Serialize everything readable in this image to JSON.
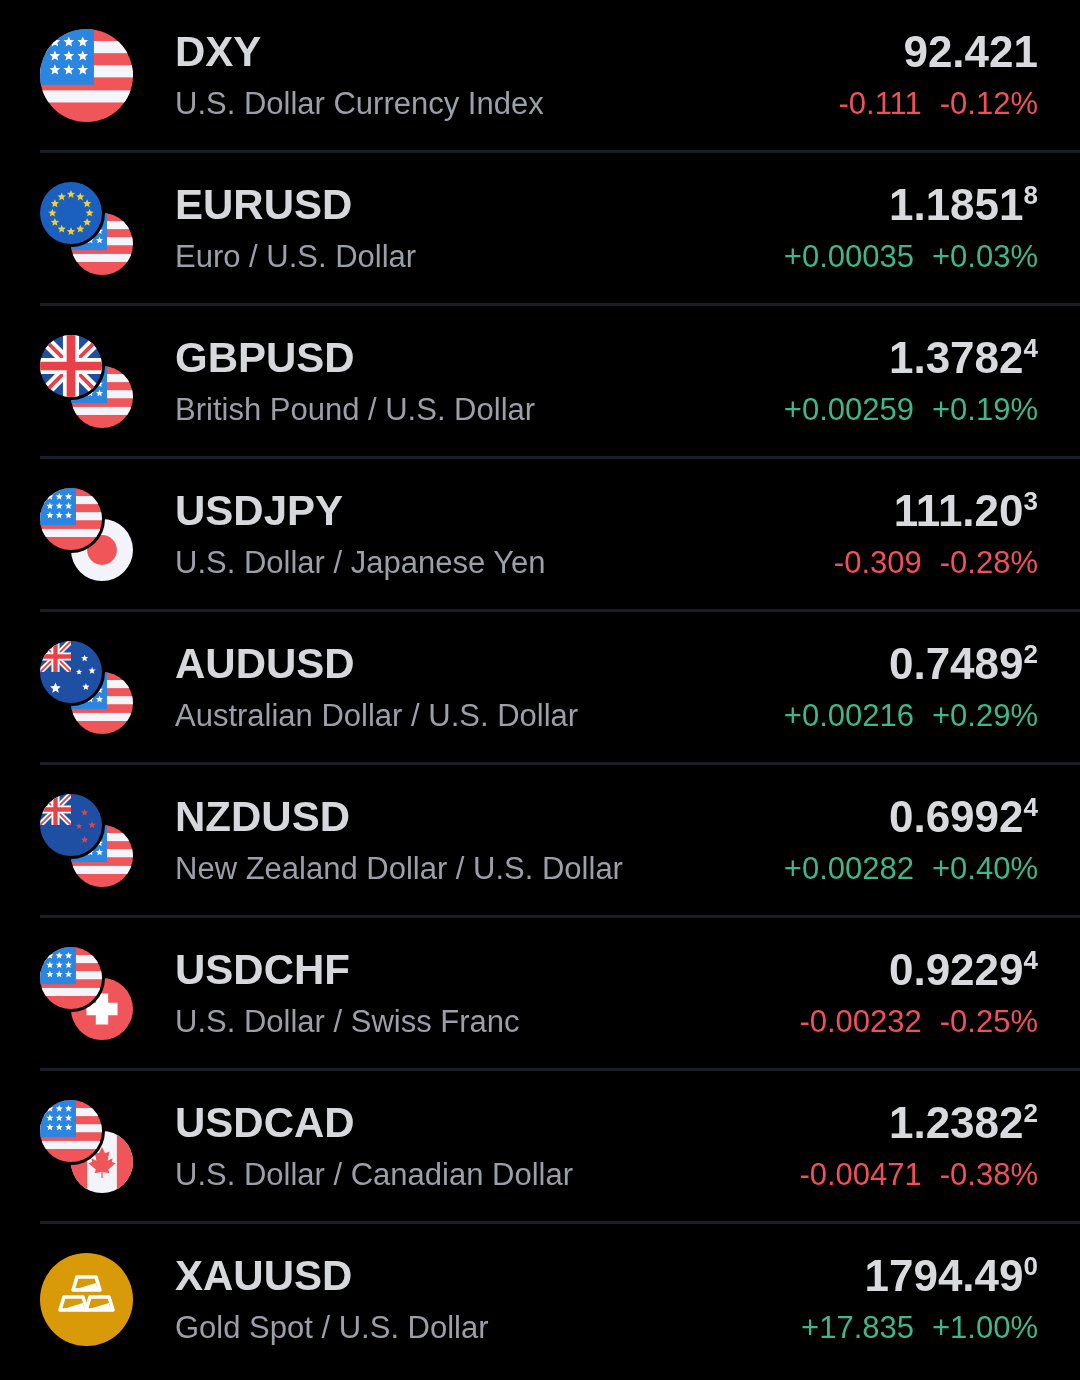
{
  "quotes": [
    {
      "symbol": "DXY",
      "description": "U.S. Dollar Currency Index",
      "price": "92.421",
      "change": "-0.111",
      "change_pct": "-0.12%",
      "color": "#f0505c"
    },
    {
      "symbol": "EURUSD",
      "description": "Euro / U.S. Dollar",
      "price": "1.1851$^{8}$",
      "change": "+0.00035",
      "change_pct": "+0.03%",
      "color": "#3fb68b"
    },
    {
      "symbol": "GBPUSD",
      "description": "British Pound / U.S. Dollar",
      "price": "1.3782$^{4}$",
      "change": "+0.00259",
      "change_pct": "+0.19%",
      "color": "#3fb68b"
    },
    {
      "symbol": "USDJPY",
      "description": "U.S. Dollar / Japanese Yen",
      "price": "111.20$^{3}$",
      "change": "-0.309",
      "change_pct": "-0.28%",
      "color": "#f0505c"
    },
    {
      "symbol": "AUDUSD",
      "description": "Australian Dollar / U.S. Dollar",
      "price": "0.7489$^{2}$",
      "change": "+0.00216",
      "change_pct": "+0.29%",
      "color": "#3fb68b"
    },
    {
      "symbol": "NZDUSD",
      "description": "New Zealand Dollar / U.S. Dollar",
      "price": "0.6992$^{4}$",
      "change": "+0.00282",
      "change_pct": "+0.40%",
      "color": "#3fb68b"
    },
    {
      "symbol": "USDCHF",
      "description": "U.S. Dollar / Swiss Franc",
      "price": "0.9229$^{4}$",
      "change": "-0.00232",
      "change_pct": "-0.25%",
      "color": "#f0505c"
    },
    {
      "symbol": "USDCAD",
      "description": "U.S. Dollar / Canadian Dollar",
      "price": "1.2382$^{2}$",
      "change": "-0.00471",
      "change_pct": "-0.38%",
      "color": "#f0505c"
    },
    {
      "symbol": "XAUUSD",
      "description": "Gold Spot / U.S. Dollar",
      "price": "1794.49$^{0}$",
      "change": "+17.835",
      "change_pct": "+1.00%",
      "color": "#3fb68b"
    }
  ]
}
